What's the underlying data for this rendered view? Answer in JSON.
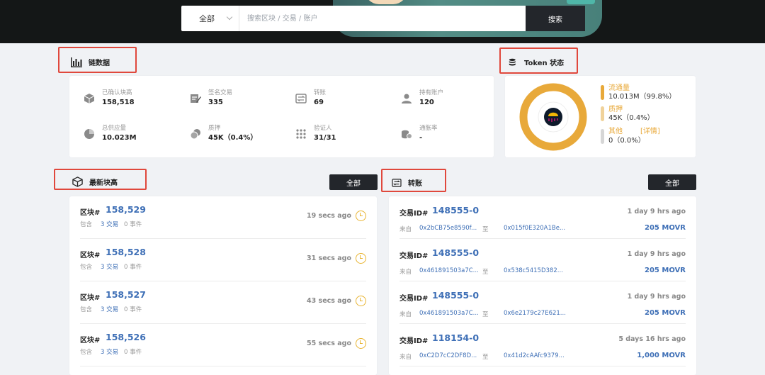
{
  "search": {
    "scope": "全部",
    "placeholder": "搜索区块 / 交易 / 账户",
    "button": "搜索"
  },
  "chain_data": {
    "title": "链数据",
    "stats": [
      {
        "icon": "cube-icon",
        "label": "已确认块高",
        "value": "158,518"
      },
      {
        "icon": "signature-icon",
        "label": "签名交易",
        "value": "335"
      },
      {
        "icon": "transfer-icon",
        "label": "转账",
        "value": "69"
      },
      {
        "icon": "user-icon",
        "label": "持有账户",
        "value": "120"
      },
      {
        "icon": "pie-icon",
        "label": "总供应量",
        "value": "10.023M"
      },
      {
        "icon": "coins-icon",
        "label": "质押",
        "value": "45K（0.4%）"
      },
      {
        "icon": "grid-icon",
        "label": "验证人",
        "value": "31/31"
      },
      {
        "icon": "stack-coins-icon",
        "label": "通胀率",
        "value": "-"
      }
    ]
  },
  "token": {
    "title": "Token 状态",
    "items": [
      {
        "label": "流通量",
        "value": "10.013M（99.8%）",
        "color": "#e8a93a"
      },
      {
        "label": "质押",
        "value": "45K（0.4%）",
        "color": "#f0d29a"
      },
      {
        "label": "其他",
        "value": "0（0.0%）",
        "color": "#d6d6d6"
      }
    ],
    "detail_link": "[详情]",
    "accent": "#e8a93a"
  },
  "blocks": {
    "title": "最新块高",
    "all_button": "全部",
    "rows": [
      {
        "label": "区块#",
        "number": "158,529",
        "contains": "包含",
        "tx": "3 交易",
        "events": "0 事件",
        "ago": "19 secs ago"
      },
      {
        "label": "区块#",
        "number": "158,528",
        "contains": "包含",
        "tx": "3 交易",
        "events": "0 事件",
        "ago": "31 secs ago"
      },
      {
        "label": "区块#",
        "number": "158,527",
        "contains": "包含",
        "tx": "3 交易",
        "events": "0 事件",
        "ago": "43 secs ago"
      },
      {
        "label": "区块#",
        "number": "158,526",
        "contains": "包含",
        "tx": "3 交易",
        "events": "0 事件",
        "ago": "55 secs ago"
      }
    ]
  },
  "transfers": {
    "title": "转账",
    "all_button": "全部",
    "rows": [
      {
        "label": "交易ID#",
        "id": "148555-0",
        "ago": "1 day 9 hrs ago",
        "from_label": "来自",
        "from": "0x2bCB75e8590f...",
        "to_label": "至",
        "to": "0x015f0E320A1Be...",
        "amount": "205 MOVR"
      },
      {
        "label": "交易ID#",
        "id": "148555-0",
        "ago": "1 day 9 hrs ago",
        "from_label": "来自",
        "from": "0x461891503a7C...",
        "to_label": "至",
        "to": "0x538c5415D382...",
        "amount": "205 MOVR"
      },
      {
        "label": "交易ID#",
        "id": "148555-0",
        "ago": "1 day 9 hrs ago",
        "from_label": "来自",
        "from": "0x461891503a7C...",
        "to_label": "至",
        "to": "0x6e2179c27E621...",
        "amount": "205 MOVR"
      },
      {
        "label": "交易ID#",
        "id": "118154-0",
        "ago": "5 days 16 hrs ago",
        "from_label": "来自",
        "from": "0xC2D7cC2DF8D...",
        "to_label": "至",
        "to": "0x41d2cAAfc9379...",
        "amount": "1,000 MOVR"
      }
    ]
  },
  "colors": {
    "link": "#3e6fb6",
    "highlight_box": "#e0483c",
    "dark_button": "#23262b"
  }
}
